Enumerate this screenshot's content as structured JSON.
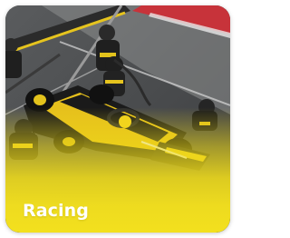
{
  "tile": {
    "label": "Racing",
    "image_subject": "race-car-pit-stop",
    "accent_color": "#f3e01e"
  }
}
